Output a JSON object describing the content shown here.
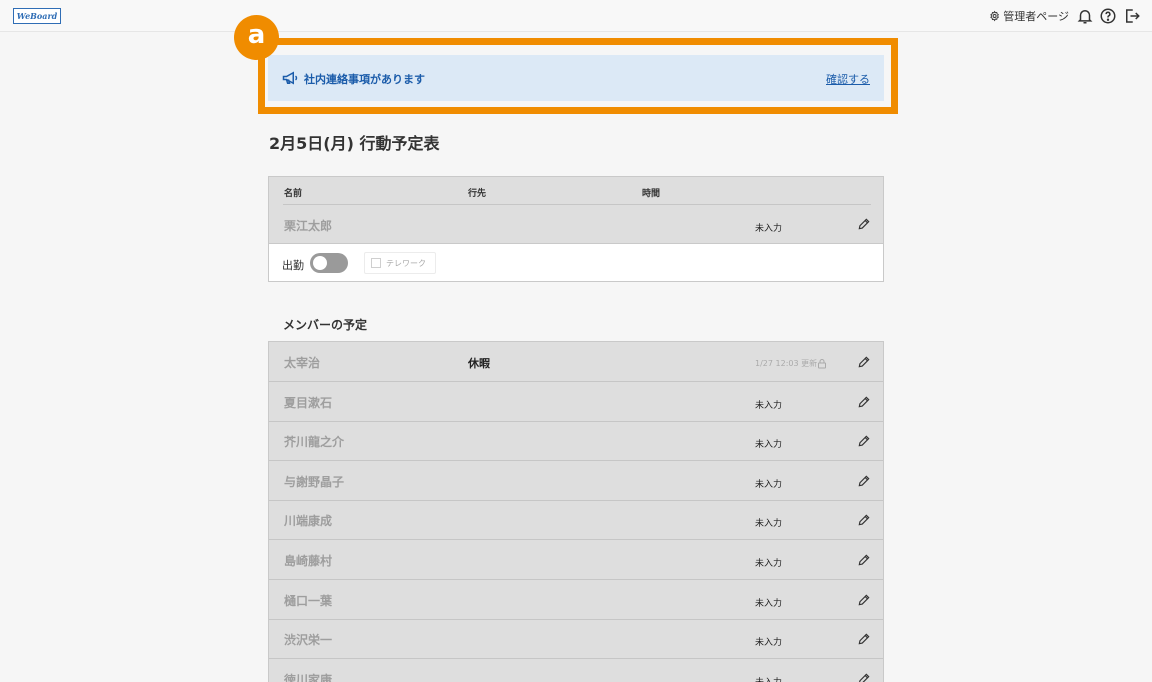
{
  "header": {
    "logo_text": "WeBoard",
    "admin_label": "管理者ページ",
    "icons": [
      "gear-icon",
      "bell-icon",
      "help-icon",
      "logout-icon"
    ]
  },
  "annotation": {
    "badge": "a",
    "highlight_color": "#f08c00"
  },
  "notice": {
    "icon": "megaphone-icon",
    "text": "社内連絡事項があります",
    "link": "確認する",
    "color": "#1b5caa",
    "background": "#dce9f6"
  },
  "page_title": "2月5日(月) 行動予定表",
  "my_schedule": {
    "columns": {
      "name": "名前",
      "destination": "行先",
      "time": "時間"
    },
    "row": {
      "name": "栗江太郎",
      "status": "未入力"
    },
    "attendance_label": "出勤",
    "attendance_on": false,
    "telework_label": "テレワーク",
    "telework_checked": false
  },
  "members_title": "メンバーの予定",
  "members": [
    {
      "name": "太宰治",
      "destination": "休暇",
      "updated": "1/27 12:03 更新",
      "status": ""
    },
    {
      "name": "夏目漱石",
      "destination": "",
      "updated": "",
      "status": "未入力"
    },
    {
      "name": "芥川龍之介",
      "destination": "",
      "updated": "",
      "status": "未入力"
    },
    {
      "name": "与謝野晶子",
      "destination": "",
      "updated": "",
      "status": "未入力"
    },
    {
      "name": "川端康成",
      "destination": "",
      "updated": "",
      "status": "未入力"
    },
    {
      "name": "島崎藤村",
      "destination": "",
      "updated": "",
      "status": "未入力"
    },
    {
      "name": "樋口一葉",
      "destination": "",
      "updated": "",
      "status": "未入力"
    },
    {
      "name": "渋沢栄一",
      "destination": "",
      "updated": "",
      "status": "未入力"
    },
    {
      "name": "徳川家康",
      "destination": "",
      "updated": "",
      "status": "未入力"
    }
  ]
}
